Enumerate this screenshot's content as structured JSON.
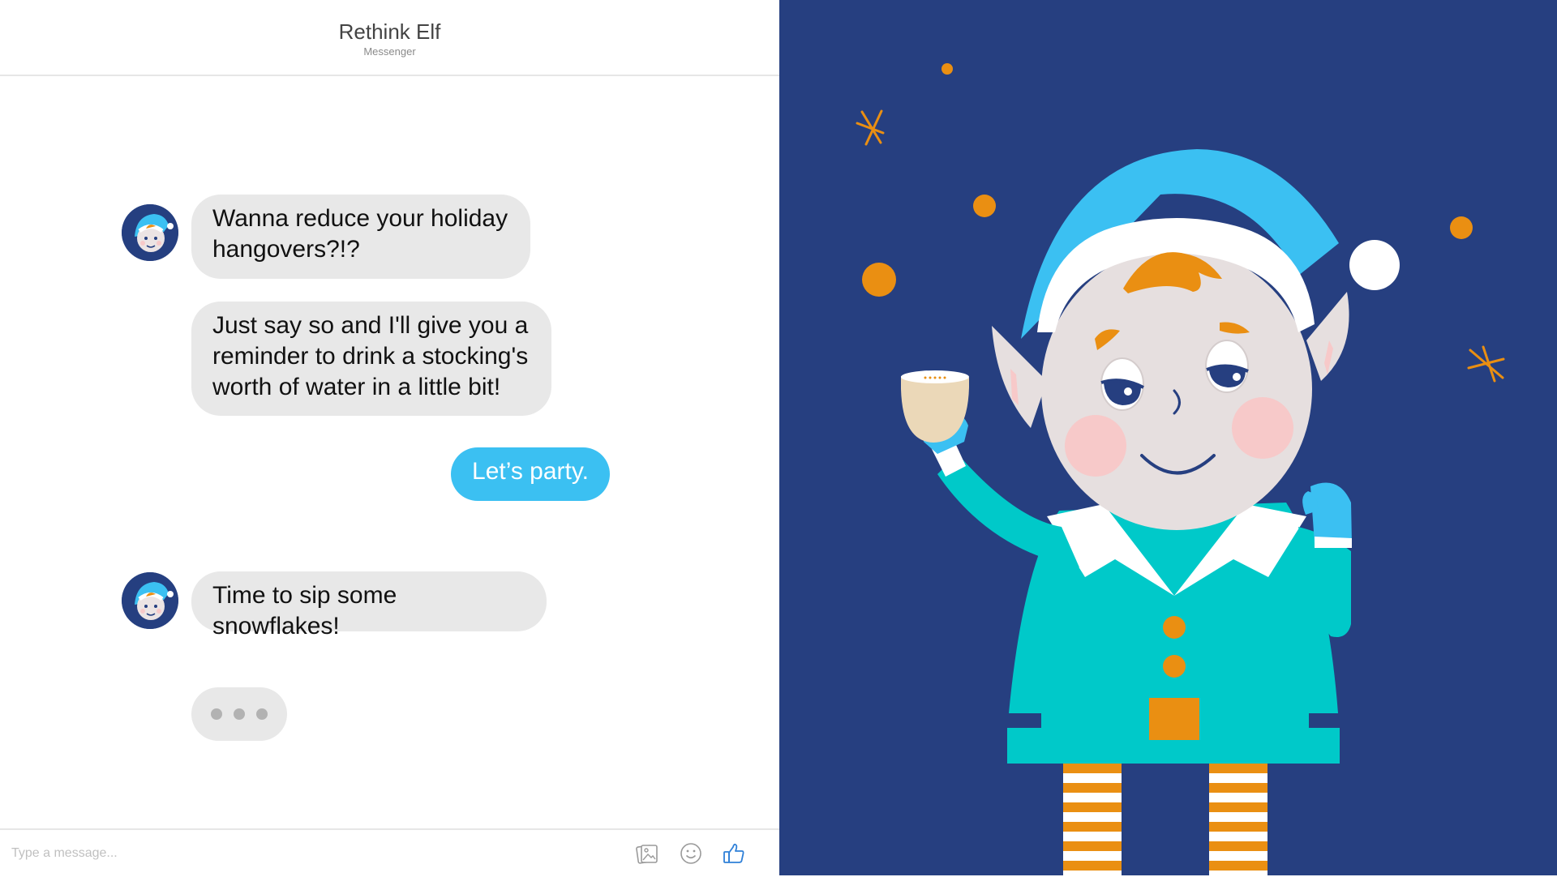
{
  "header": {
    "title": "Rethink Elf",
    "subtitle": "Messenger"
  },
  "messages": [
    {
      "sender": "bot",
      "text": "Wanna reduce your holiday hangovers?!?"
    },
    {
      "sender": "bot",
      "text": "Just say so and I'll give you a reminder to drink a stocking's worth of water in a little bit!"
    },
    {
      "sender": "user",
      "text": "Let’s party."
    },
    {
      "sender": "bot",
      "text": "Time to sip some snowflakes!"
    }
  ],
  "typing_indicator": {
    "dots": 3
  },
  "composer": {
    "placeholder": "Type a message...",
    "icons": [
      "photo-icon",
      "emoji-icon",
      "thumbs-up-icon"
    ]
  },
  "colors": {
    "accent": "#3bc0f2",
    "bot_bubble": "#e8e8e8",
    "art_background": "#263f80",
    "like_icon": "#2f80d8"
  }
}
